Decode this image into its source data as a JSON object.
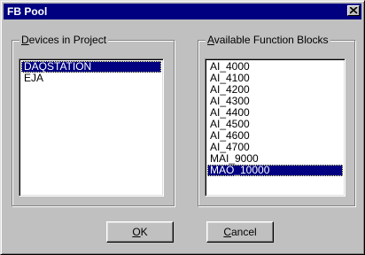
{
  "window": {
    "title": "FB Pool",
    "close_icon": "close-icon"
  },
  "devices": {
    "label_mnemonic": "D",
    "label_rest": "evices in Project",
    "items": [
      {
        "label": "DAQSTATION",
        "selected": true
      },
      {
        "label": "EJA",
        "selected": false
      }
    ]
  },
  "function_blocks": {
    "label_mnemonic": "A",
    "label_rest": "vailable Function Blocks",
    "items": [
      {
        "label": "AI_4000",
        "selected": false
      },
      {
        "label": "AI_4100",
        "selected": false
      },
      {
        "label": "AI_4200",
        "selected": false
      },
      {
        "label": "AI_4300",
        "selected": false
      },
      {
        "label": "AI_4400",
        "selected": false
      },
      {
        "label": "AI_4500",
        "selected": false
      },
      {
        "label": "AI_4600",
        "selected": false
      },
      {
        "label": "AI_4700",
        "selected": false
      },
      {
        "label": "MAI_9000",
        "selected": false
      },
      {
        "label": "MAO_10000",
        "selected": true
      }
    ]
  },
  "buttons": {
    "ok_mnemonic": "O",
    "ok_rest": "K",
    "cancel_mnemonic": "C",
    "cancel_rest": "ancel"
  },
  "colors": {
    "titlebar": "#000080",
    "face": "#c0c0c0",
    "selection": "#000080"
  }
}
